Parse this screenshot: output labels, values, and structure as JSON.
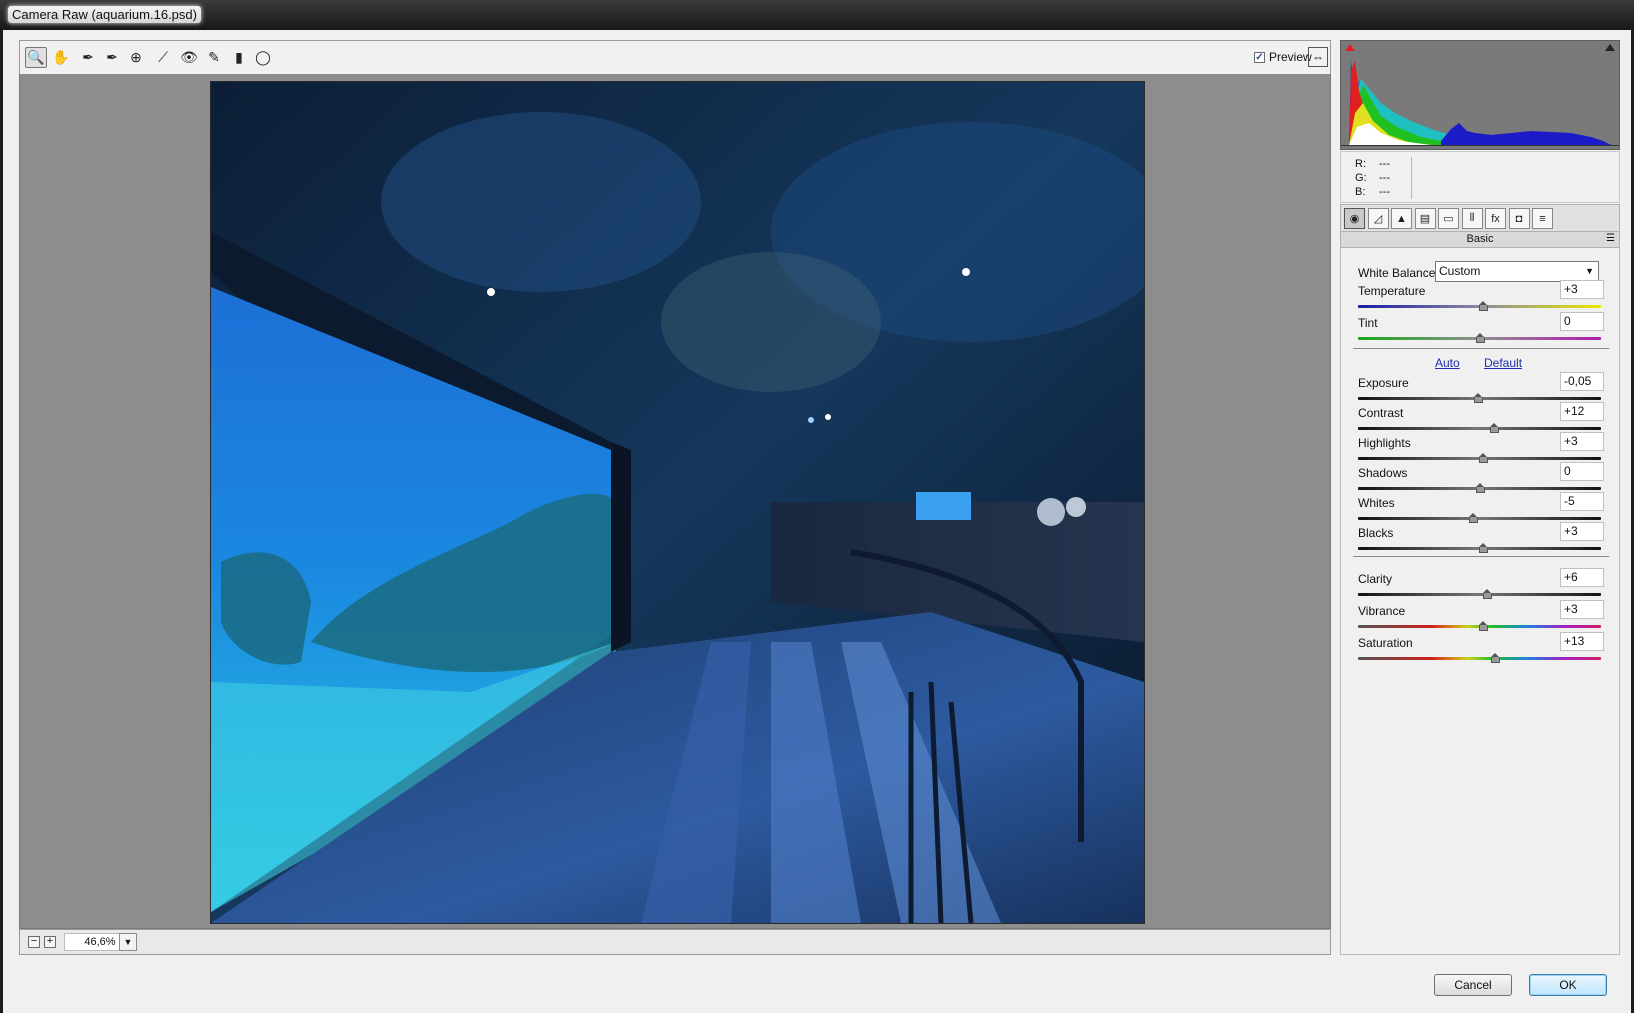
{
  "window": {
    "title": "Camera Raw (aquarium.16.psd)"
  },
  "toolbar": {
    "tools": [
      {
        "name": "zoom-tool-icon",
        "glyph": "🔍"
      },
      {
        "name": "hand-tool-icon",
        "glyph": "✋"
      },
      {
        "name": "white-balance-tool-icon",
        "glyph": "✒"
      },
      {
        "name": "color-sampler-tool-icon",
        "glyph": "✒"
      },
      {
        "name": "targeted-adjustment-tool-icon",
        "glyph": "⊕"
      },
      {
        "name": "straighten-tool-icon",
        "glyph": "⟋"
      },
      {
        "name": "red-eye-tool-icon",
        "glyph": "👁"
      },
      {
        "name": "adjustment-brush-icon",
        "glyph": "✎"
      },
      {
        "name": "graduated-filter-icon",
        "glyph": "▮"
      },
      {
        "name": "radial-filter-icon",
        "glyph": "◯"
      }
    ],
    "preview_label": "Preview",
    "preview_checked": true,
    "fullscreen_glyph": "⇔"
  },
  "status": {
    "zoom": "46,6%",
    "zoom_out": "−",
    "zoom_in": "+"
  },
  "readout": {
    "r_label": "R:",
    "r_value": "---",
    "g_label": "G:",
    "g_value": "---",
    "b_label": "B:",
    "b_value": "---"
  },
  "panel": {
    "tabs": [
      {
        "name": "tab-basic",
        "glyph": "◉",
        "active": true
      },
      {
        "name": "tab-tone-curve",
        "glyph": "◿"
      },
      {
        "name": "tab-detail",
        "glyph": "▲"
      },
      {
        "name": "tab-hsl",
        "glyph": "▤"
      },
      {
        "name": "tab-split-toning",
        "glyph": "▭"
      },
      {
        "name": "tab-lens-corrections",
        "glyph": "⫴"
      },
      {
        "name": "tab-effects",
        "glyph": "fx"
      },
      {
        "name": "tab-camera-calibration",
        "glyph": "◘"
      },
      {
        "name": "tab-presets",
        "glyph": "≡"
      }
    ],
    "header": "Basic",
    "wb_label": "White Balance:",
    "wb_value": "Custom",
    "auto_label": "Auto",
    "default_label": "Default",
    "sliders": [
      {
        "label": "Temperature",
        "value": "+3",
        "pos": 0.515,
        "track": "temp"
      },
      {
        "label": "Tint",
        "value": "0",
        "pos": 0.5,
        "track": "tint"
      },
      {
        "label": "Exposure",
        "value": "-0,05",
        "pos": 0.494,
        "track": "tone"
      },
      {
        "label": "Contrast",
        "value": "+12",
        "pos": 0.56,
        "track": "tone"
      },
      {
        "label": "Highlights",
        "value": "+3",
        "pos": 0.515,
        "track": "tone"
      },
      {
        "label": "Shadows",
        "value": "0",
        "pos": 0.5,
        "track": "tone"
      },
      {
        "label": "Whites",
        "value": "-5",
        "pos": 0.475,
        "track": "tone"
      },
      {
        "label": "Blacks",
        "value": "+3",
        "pos": 0.515,
        "track": "tone"
      },
      {
        "label": "Clarity",
        "value": "+6",
        "pos": 0.53,
        "track": "tone"
      },
      {
        "label": "Vibrance",
        "value": "+3",
        "pos": 0.515,
        "track": "hue"
      },
      {
        "label": "Saturation",
        "value": "+13",
        "pos": 0.565,
        "track": "hue"
      }
    ]
  },
  "buttons": {
    "cancel": "Cancel",
    "ok": "OK"
  },
  "colors": {
    "temp_track": [
      "#1a1aa8",
      "#e8e800"
    ],
    "tint_track": [
      "#17a817",
      "#b01ab0"
    ],
    "accent_ok": "#3c7fb1"
  }
}
